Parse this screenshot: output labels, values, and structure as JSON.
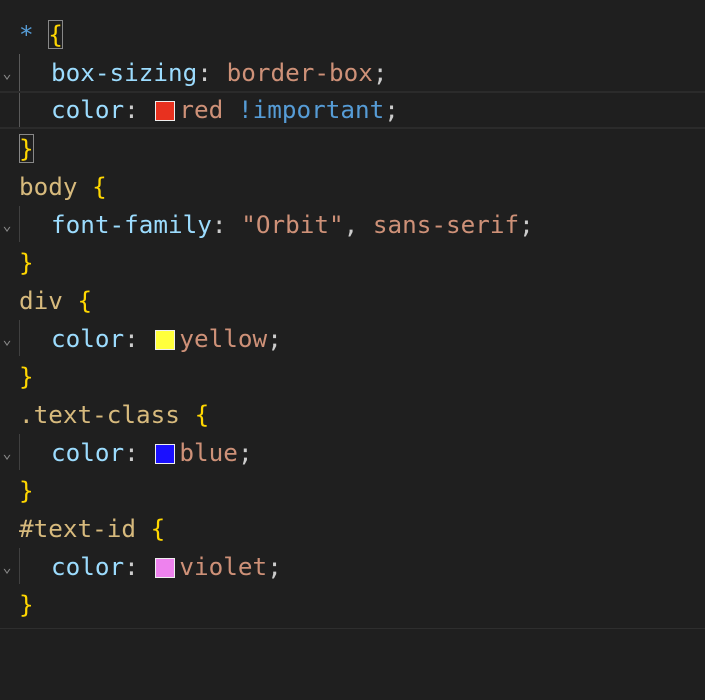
{
  "rules": [
    {
      "selector": "*",
      "declarations": [
        {
          "property": "box-sizing",
          "value": "border-box"
        },
        {
          "property": "color",
          "value": "red",
          "important": "!important",
          "swatch": "#e8311f"
        }
      ]
    },
    {
      "selector": "body",
      "declarations": [
        {
          "property": "font-family",
          "value": "\"Orbit\"",
          "value2": "sans-serif"
        }
      ]
    },
    {
      "selector": "div",
      "declarations": [
        {
          "property": "color",
          "value": "yellow",
          "swatch": "#ffff3c"
        }
      ]
    },
    {
      "selector": ".text-class",
      "declarations": [
        {
          "property": "color",
          "value": "blue",
          "swatch": "#1a10ff"
        }
      ]
    },
    {
      "selector": "#text-id",
      "declarations": [
        {
          "property": "color",
          "value": "violet",
          "swatch": "#ee82ee"
        }
      ]
    }
  ],
  "syntax": {
    "open_brace": "{",
    "close_brace": "}",
    "colon": ":",
    "semicolon": ";",
    "comma": ","
  },
  "icons": {
    "fold": "chevron-fold-icon"
  },
  "colors": {
    "background": "#1f1f1f",
    "selector": "#d7ba7d",
    "property": "#9cdcfe",
    "value": "#ce9178",
    "keyword": "#569cd6",
    "brace": "#ffd700"
  }
}
